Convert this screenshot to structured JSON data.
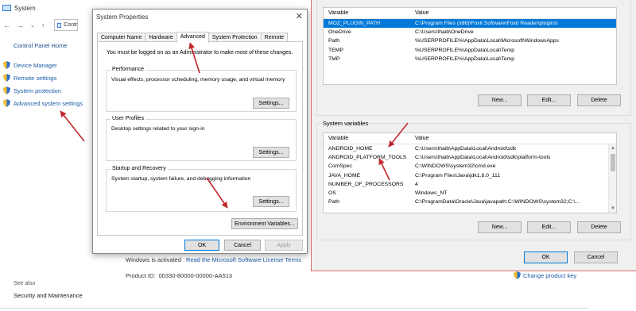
{
  "system_window": {
    "title": "System",
    "address_text": "Contr",
    "control_panel_home": "Control Panel Home",
    "sidebar": [
      {
        "label": "Device Manager",
        "icon": "shield-icon"
      },
      {
        "label": "Remote settings",
        "icon": "shield-icon"
      },
      {
        "label": "System protection",
        "icon": "shield-icon"
      },
      {
        "label": "Advanced system settings",
        "icon": "shield-icon"
      }
    ],
    "see_also": "See also",
    "security_maintenance": "Security and Maintenance",
    "activation_text": "Windows is activated",
    "license_link": "Read the Microsoft Software License Terms",
    "product_id_label": "Product ID:",
    "product_id_value": "00330-80000-00000-AA513",
    "change_key": "Change product key"
  },
  "system_properties": {
    "title": "System Properties",
    "tabs": [
      "Computer Name",
      "Hardware",
      "Advanced",
      "System Protection",
      "Remote"
    ],
    "active_tab": "Advanced",
    "admin_note": "You must be logged on as an Administrator to make most of these changes.",
    "performance": {
      "label": "Performance",
      "desc": "Visual effects, processor scheduling, memory usage, and virtual memory",
      "button": "Settings..."
    },
    "user_profiles": {
      "label": "User Profiles",
      "desc": "Desktop settings related to your sign-in",
      "button": "Settings..."
    },
    "startup_recovery": {
      "label": "Startup and Recovery",
      "desc": "System startup, system failure, and debugging information",
      "button": "Settings..."
    },
    "env_button": "Environment Variables...",
    "ok": "OK",
    "cancel": "Cancel",
    "apply": "Apply"
  },
  "env_vars": {
    "user_headers": [
      "Variable",
      "Value"
    ],
    "user_rows": [
      {
        "name": "MOZ_PLUGIN_PATH",
        "value": "C:\\Program Files (x86)\\Foxit Software\\Foxit Reader\\plugins\\"
      },
      {
        "name": "OneDrive",
        "value": "C:\\Users\\thaib\\OneDrive"
      },
      {
        "name": "Path",
        "value": "%USERPROFILE%\\AppData\\Local\\Microsoft\\WindowsApps"
      },
      {
        "name": "TEMP",
        "value": "%USERPROFILE%\\AppData\\Local\\Temp"
      },
      {
        "name": "TMP",
        "value": "%USERPROFILE%\\AppData\\Local\\Temp"
      }
    ],
    "user_buttons": [
      "New...",
      "Edit...",
      "Delete"
    ],
    "system_label": "System variables",
    "system_headers": [
      "Variable",
      "Value"
    ],
    "system_rows": [
      {
        "name": "ANDROID_HOME",
        "value": "C:\\Users\\thaib\\AppData\\Local\\Android\\sdk"
      },
      {
        "name": "ANDROID_PLATFORM_TOOLS",
        "value": "C:\\Users\\thaib\\AppData\\Local\\Android\\sdk\\platform-tools"
      },
      {
        "name": "ComSpec",
        "value": "C:\\WINDOWS\\system32\\cmd.exe"
      },
      {
        "name": "JAVA_HOME",
        "value": "C:\\Program Files\\Java\\jdk1.8.0_111"
      },
      {
        "name": "NUMBER_OF_PROCESSORS",
        "value": "4"
      },
      {
        "name": "OS",
        "value": "Windows_NT"
      },
      {
        "name": "Path",
        "value": "C:\\ProgramData\\Oracle\\Java\\javapath;C:\\WINDOWS\\system32;C:\\..."
      }
    ],
    "system_buttons": [
      "New...",
      "Edit...",
      "Delete"
    ],
    "ok": "OK",
    "cancel": "Cancel"
  },
  "colors": {
    "selection": "#0078d7",
    "arrow": "#c0272d",
    "link": "#1a5aa6",
    "dialog_border": "#e06a6a"
  }
}
